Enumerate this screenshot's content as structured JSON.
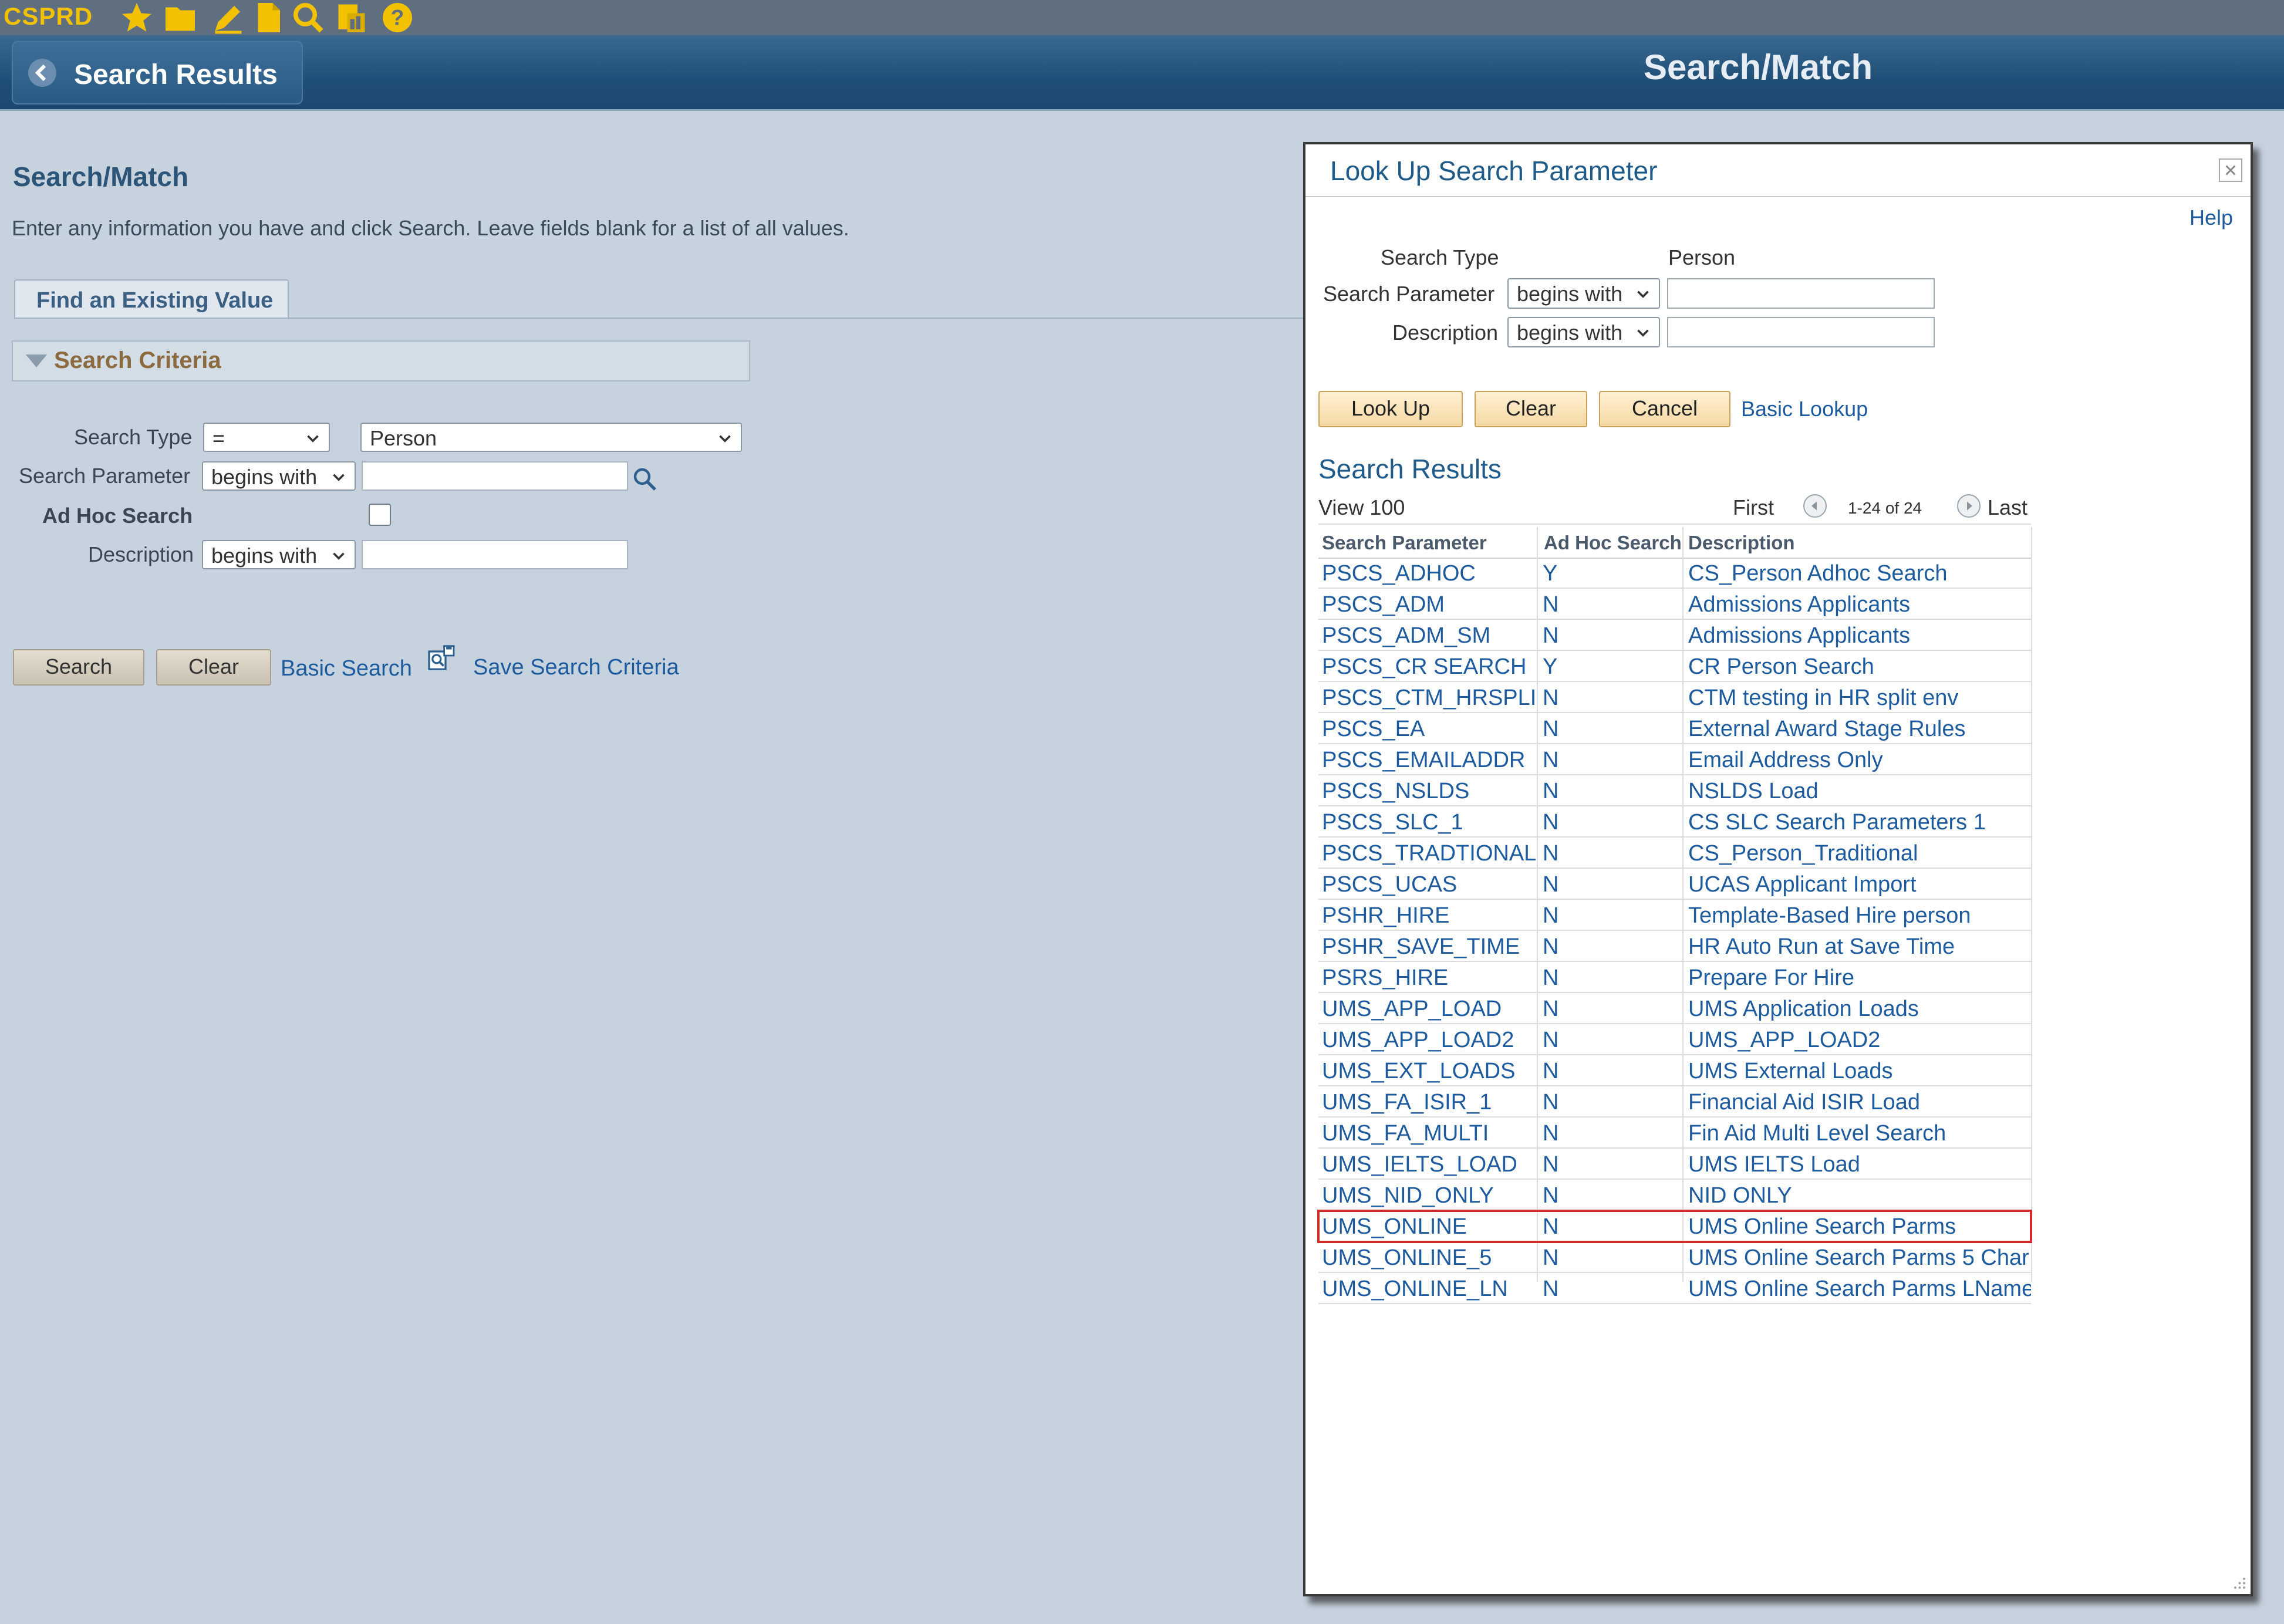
{
  "toolbar": {
    "app_name": "CSPRD",
    "icons": [
      "star-icon",
      "folder-icon",
      "pencil-icon",
      "document-icon",
      "magnifier-icon",
      "report-icon",
      "help-icon"
    ]
  },
  "nav": {
    "back_label": "Search Results",
    "header_title": "Search/Match"
  },
  "page": {
    "title": "Search/Match",
    "instructions": "Enter any information you have and click Search. Leave fields blank for a list of all values.",
    "tab_label": "Find an Existing Value",
    "criteria_label": "Search Criteria",
    "fields": {
      "search_type_label": "Search Type",
      "search_type_op": "=",
      "search_type_value": "Person",
      "search_param_label": "Search Parameter",
      "search_param_op": "begins with",
      "adhoc_label": "Ad Hoc Search",
      "description_label": "Description",
      "description_op": "begins with"
    },
    "buttons": {
      "search": "Search",
      "clear": "Clear",
      "basic_search": "Basic Search",
      "save_criteria": "Save Search Criteria"
    }
  },
  "modal": {
    "title": "Look Up Search Parameter",
    "help": "Help",
    "search_type_label": "Search Type",
    "search_type_value": "Person",
    "search_param_label": "Search Parameter",
    "search_param_op": "begins with",
    "description_label": "Description",
    "description_op": "begins with",
    "buttons": {
      "lookup": "Look Up",
      "clear": "Clear",
      "cancel": "Cancel",
      "basic_lookup": "Basic Lookup"
    },
    "results_title": "Search Results",
    "view": "View 100",
    "first": "First",
    "range": "1-24 of 24",
    "last": "Last",
    "columns": [
      "Search Parameter",
      "Ad Hoc Search",
      "Description"
    ],
    "rows": [
      {
        "param": "PSCS_ADHOC",
        "adhoc": "Y",
        "desc": "CS_Person Adhoc Search"
      },
      {
        "param": "PSCS_ADM",
        "adhoc": "N",
        "desc": "Admissions Applicants"
      },
      {
        "param": "PSCS_ADM_SM",
        "adhoc": "N",
        "desc": "Admissions Applicants"
      },
      {
        "param": "PSCS_CR SEARCH",
        "adhoc": "Y",
        "desc": "CR Person Search"
      },
      {
        "param": "PSCS_CTM_HRSPLI",
        "adhoc": "N",
        "desc": "CTM testing in HR split env"
      },
      {
        "param": "PSCS_EA",
        "adhoc": "N",
        "desc": "External Award Stage Rules"
      },
      {
        "param": "PSCS_EMAILADDR",
        "adhoc": "N",
        "desc": "Email Address Only"
      },
      {
        "param": "PSCS_NSLDS",
        "adhoc": "N",
        "desc": "NSLDS Load"
      },
      {
        "param": "PSCS_SLC_1",
        "adhoc": "N",
        "desc": "CS SLC Search Parameters 1"
      },
      {
        "param": "PSCS_TRADTIONAL",
        "adhoc": "N",
        "desc": "CS_Person_Traditional"
      },
      {
        "param": "PSCS_UCAS",
        "adhoc": "N",
        "desc": "UCAS Applicant Import"
      },
      {
        "param": "PSHR_HIRE",
        "adhoc": "N",
        "desc": "Template-Based Hire person"
      },
      {
        "param": "PSHR_SAVE_TIME",
        "adhoc": "N",
        "desc": "HR Auto Run at Save Time"
      },
      {
        "param": "PSRS_HIRE",
        "adhoc": "N",
        "desc": "Prepare For Hire"
      },
      {
        "param": "UMS_APP_LOAD",
        "adhoc": "N",
        "desc": "UMS Application Loads"
      },
      {
        "param": "UMS_APP_LOAD2",
        "adhoc": "N",
        "desc": "UMS_APP_LOAD2"
      },
      {
        "param": "UMS_EXT_LOADS",
        "adhoc": "N",
        "desc": "UMS External Loads"
      },
      {
        "param": "UMS_FA_ISIR_1",
        "adhoc": "N",
        "desc": "Financial Aid ISIR Load"
      },
      {
        "param": "UMS_FA_MULTI",
        "adhoc": "N",
        "desc": "Fin Aid Multi Level Search"
      },
      {
        "param": "UMS_IELTS_LOAD",
        "adhoc": "N",
        "desc": "UMS IELTS Load"
      },
      {
        "param": "UMS_NID_ONLY",
        "adhoc": "N",
        "desc": "NID ONLY"
      },
      {
        "param": "UMS_ONLINE",
        "adhoc": "N",
        "desc": "UMS Online Search Parms"
      },
      {
        "param": "UMS_ONLINE_5",
        "adhoc": "N",
        "desc": "UMS Online Search Parms 5 Char"
      },
      {
        "param": "UMS_ONLINE_LN",
        "adhoc": "N",
        "desc": "UMS Online Search Parms LName"
      }
    ],
    "selected_row": 21
  }
}
